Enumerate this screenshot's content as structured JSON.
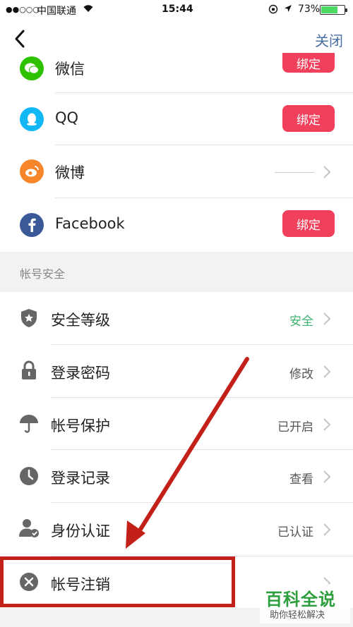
{
  "status_bar": {
    "signal": "●●○○○",
    "carrier": "中国联通",
    "wifi_icon": "wifi-icon",
    "time": "15:44",
    "battery_percent": "73%",
    "battery_level": 0.73
  },
  "nav": {
    "back_icon": "chevron-left-icon",
    "close_label": "关闭"
  },
  "social_accounts": [
    {
      "name": "微信",
      "icon": "wechat-icon",
      "color": "#2dc100",
      "action": "绑定"
    },
    {
      "name": "QQ",
      "icon": "qq-icon",
      "color": "#12b7f5",
      "action": "绑定"
    },
    {
      "name": "微博",
      "icon": "weibo-icon",
      "color": "#f7852a",
      "action": ""
    },
    {
      "name": "Facebook",
      "icon": "facebook-icon",
      "color": "#3b5998",
      "action": "绑定"
    }
  ],
  "section_title": "帐号安全",
  "security_items": [
    {
      "label": "安全等级",
      "icon": "shield-star-icon",
      "value": "安全"
    },
    {
      "label": "登录密码",
      "icon": "lock-icon",
      "value": "修改"
    },
    {
      "label": "帐号保护",
      "icon": "umbrella-icon",
      "value": "已开启"
    },
    {
      "label": "登录记录",
      "icon": "clock-icon",
      "value": "查看"
    },
    {
      "label": "身份认证",
      "icon": "user-verified-icon",
      "value": "已认证"
    },
    {
      "label": "帐号注销",
      "icon": "close-circle-icon",
      "value": ""
    }
  ],
  "colors": {
    "bind_button": "#f0405b",
    "safe_value": "#3cb371",
    "close_link": "#4a6fa5",
    "annotation": "#c3201a"
  },
  "watermark": {
    "title": "百科全说",
    "subtitle": "助你轻松解决"
  }
}
